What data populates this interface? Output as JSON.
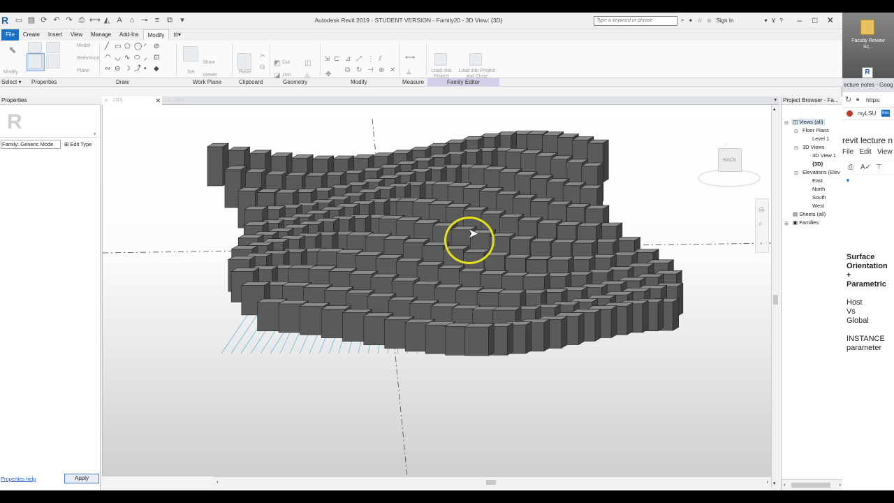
{
  "app": {
    "title": "Autodesk Revit 2019 - STUDENT VERSION - Family20 - 3D View: {3D}",
    "search_placeholder": "Type a keyword or phrase",
    "sign_in": "Sign In"
  },
  "menu": {
    "items": [
      "File",
      "Create",
      "Insert",
      "View",
      "Manage",
      "Add-Ins",
      "Modify"
    ],
    "active": "Modify"
  },
  "ribbon": {
    "panels": [
      "Select",
      "Properties",
      "Draw",
      "Work Plane",
      "Clipboard",
      "Geometry",
      "Modify",
      "Measure",
      "Family Editor"
    ],
    "select_dropdown": "▾",
    "buttons": {
      "modify": "Modify",
      "model": "Model",
      "reference": "Reference",
      "plane": "Plane",
      "set": "Set",
      "show": "Show",
      "viewer": "Viewer",
      "paste": "Paste",
      "cut": "Cut",
      "join": "Join",
      "load_into_project": "Load into Project",
      "load_into_project_close": "Load into Project and Close"
    }
  },
  "properties": {
    "header": "Properties",
    "family_select": "Family: Generic Mode",
    "edit_type": "Edit Type",
    "help_link": "Properties help",
    "apply": "Apply"
  },
  "view_tabs": [
    "{3D}",
    "{3D}"
  ],
  "viewcube": {
    "label": "BACK"
  },
  "project_browser": {
    "header": "Project Browser - Fa...",
    "nodes": [
      "Views (all)",
      "Floor Plans",
      "Level 1",
      "3D Views",
      "3D View 1",
      "{3D}",
      "Elevations (Elev",
      "East",
      "North",
      "South",
      "West",
      "Sheets (all)",
      "Families"
    ]
  },
  "side_panel": {
    "desktop_label": "Faculty Review Sc...",
    "tab": "ecture notes - Goog",
    "url": "https:",
    "bookmark": "myLSU",
    "doc_title": "revit lecture n",
    "doc_menu": [
      "File",
      "Edit",
      "View"
    ],
    "notes": [
      "Surface",
      "Orientation",
      "+",
      "Parametric",
      "",
      "Host",
      "Vs",
      "Global",
      "",
      "INSTANCE",
      "parameter"
    ]
  },
  "colors": {
    "file_tab": "#1f6fbf",
    "family_editor_tab": "#d6cfe9",
    "cursor_highlight": "#e3e31a",
    "model_block": "#5a5a5a"
  }
}
